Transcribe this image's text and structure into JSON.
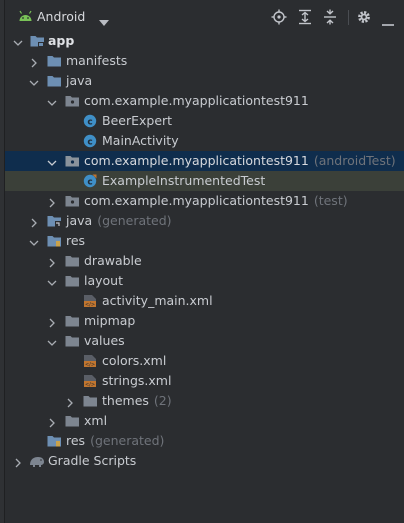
{
  "toolbar": {
    "view_label": "Android"
  },
  "tree": {
    "items": [
      {
        "label": "app",
        "suffix": ""
      },
      {
        "label": "manifests",
        "suffix": ""
      },
      {
        "label": "java",
        "suffix": ""
      },
      {
        "label": "com.example.myapplicationtest911",
        "suffix": ""
      },
      {
        "label": "BeerExpert",
        "suffix": ""
      },
      {
        "label": "MainActivity",
        "suffix": ""
      },
      {
        "label": "com.example.myapplicationtest911",
        "suffix": "(androidTest)"
      },
      {
        "label": "ExampleInstrumentedTest",
        "suffix": ""
      },
      {
        "label": "com.example.myapplicationtest911",
        "suffix": "(test)"
      },
      {
        "label": "java",
        "suffix": "(generated)"
      },
      {
        "label": "res",
        "suffix": ""
      },
      {
        "label": "drawable",
        "suffix": ""
      },
      {
        "label": "layout",
        "suffix": ""
      },
      {
        "label": "activity_main.xml",
        "suffix": ""
      },
      {
        "label": "mipmap",
        "suffix": ""
      },
      {
        "label": "values",
        "suffix": ""
      },
      {
        "label": "colors.xml",
        "suffix": ""
      },
      {
        "label": "strings.xml",
        "suffix": ""
      },
      {
        "label": "themes",
        "suffix": "(2)"
      },
      {
        "label": "xml",
        "suffix": ""
      },
      {
        "label": "res",
        "suffix": "(generated)"
      },
      {
        "label": "Gradle Scripts",
        "suffix": ""
      }
    ]
  },
  "colors": {
    "background": "#2b2d30",
    "selection": "#0f2d4d",
    "folder": "#6d8fb3",
    "java_class": "#3f8fc7",
    "xml_file": "#c0752f",
    "android_green": "#79c257"
  }
}
